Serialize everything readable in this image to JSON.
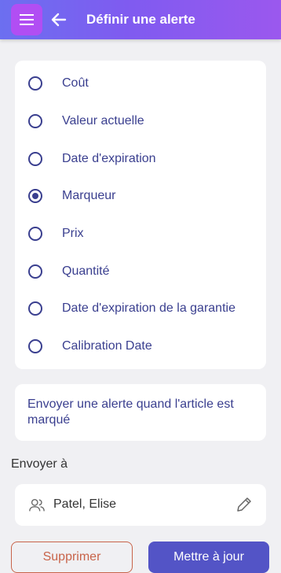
{
  "header": {
    "title": "Définir une alerte",
    "menu_icon": "hamburger-menu-icon",
    "back_icon": "arrow-left-icon",
    "gradient": [
      "#6c6ff0",
      "#9b58ee"
    ],
    "menu_bg": "#b14ef3"
  },
  "options": [
    {
      "label": "Coût",
      "checked": false
    },
    {
      "label": "Valeur actuelle",
      "checked": false
    },
    {
      "label": "Date d'expiration",
      "checked": false
    },
    {
      "label": "Marqueur",
      "checked": true
    },
    {
      "label": "Prix",
      "checked": false
    },
    {
      "label": "Quantité",
      "checked": false
    },
    {
      "label": "Date d'expiration de la garantie",
      "checked": false
    },
    {
      "label": "Calibration Date",
      "checked": false
    }
  ],
  "info": {
    "text": "Envoyer une alerte quand l'article est marqué"
  },
  "send_to": {
    "label": "Envoyer à",
    "recipient": "Patel, Elise",
    "user_icon": "users-icon",
    "edit_icon": "pencil-icon"
  },
  "actions": {
    "delete_label": "Supprimer",
    "update_label": "Mettre à jour"
  },
  "colors": {
    "primary_text": "#3a3f8f",
    "danger": "#c8644a",
    "primary_button": "#5354c6",
    "background": "#f0f0f3"
  }
}
